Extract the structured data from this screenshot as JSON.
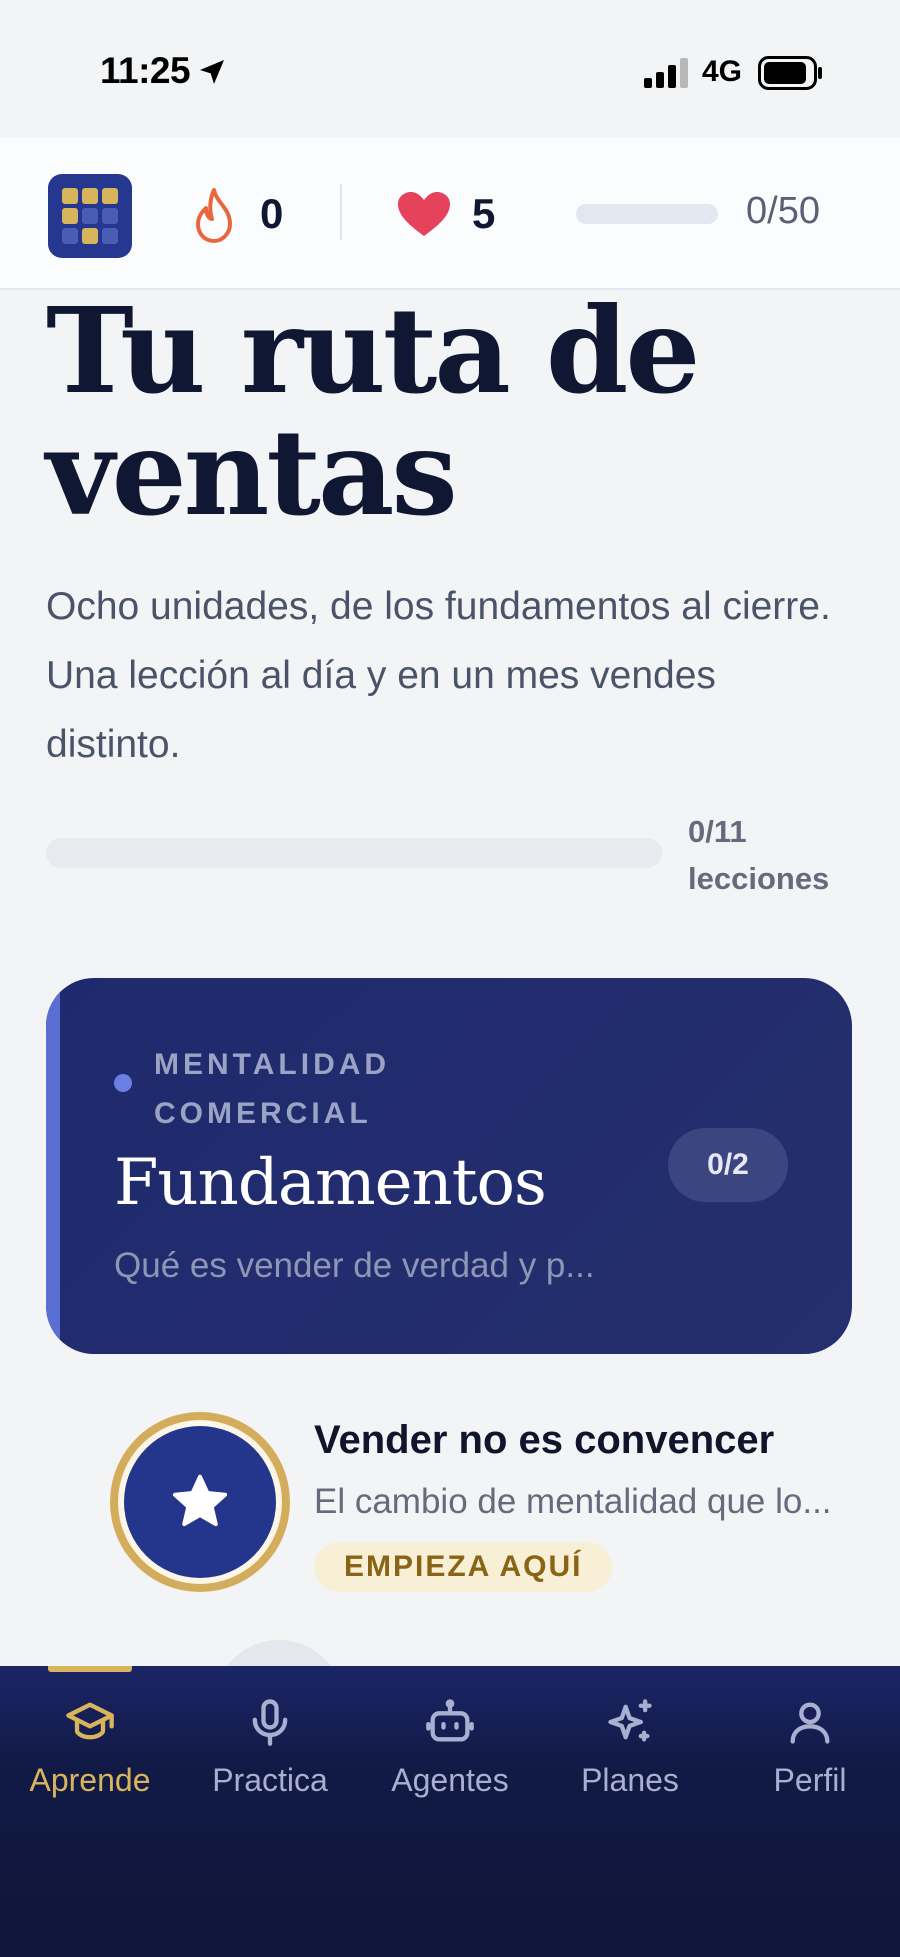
{
  "status_bar": {
    "time": "11:25",
    "network": "4G"
  },
  "top_bar": {
    "streak": "0",
    "lives": "5",
    "xp": "0/50",
    "xp_fraction": 0
  },
  "hero": {
    "title": "Tu ruta de ventas",
    "subtitle": "Ocho unidades, de los fundamentos al cierre. Una lección al día y en un mes vendes distinto.",
    "progress_count": "0/11 lecciones",
    "progress_fraction": 0
  },
  "unit": {
    "kicker": "MENTALIDAD COMERCIAL",
    "title": "Fundamentos",
    "description": "Qué es vender de verdad y p...",
    "badge": "0/2"
  },
  "lesson": {
    "title": "Vender no es convencer",
    "description": "El cambio de mentalidad que lo...",
    "cta": "EMPIEZA AQUÍ"
  },
  "bottom_nav": {
    "items": [
      {
        "label": "Aprende",
        "icon": "graduation-cap-icon",
        "active": true
      },
      {
        "label": "Practica",
        "icon": "microphone-icon",
        "active": false
      },
      {
        "label": "Agentes",
        "icon": "robot-icon",
        "active": false
      },
      {
        "label": "Planes",
        "icon": "sparkles-icon",
        "active": false
      },
      {
        "label": "Perfil",
        "icon": "user-icon",
        "active": false
      }
    ]
  },
  "colors": {
    "brand": "#25378e",
    "accent_gold": "#d8b45d",
    "streak_orange": "#e8673f",
    "heart_red": "#e5435b"
  }
}
